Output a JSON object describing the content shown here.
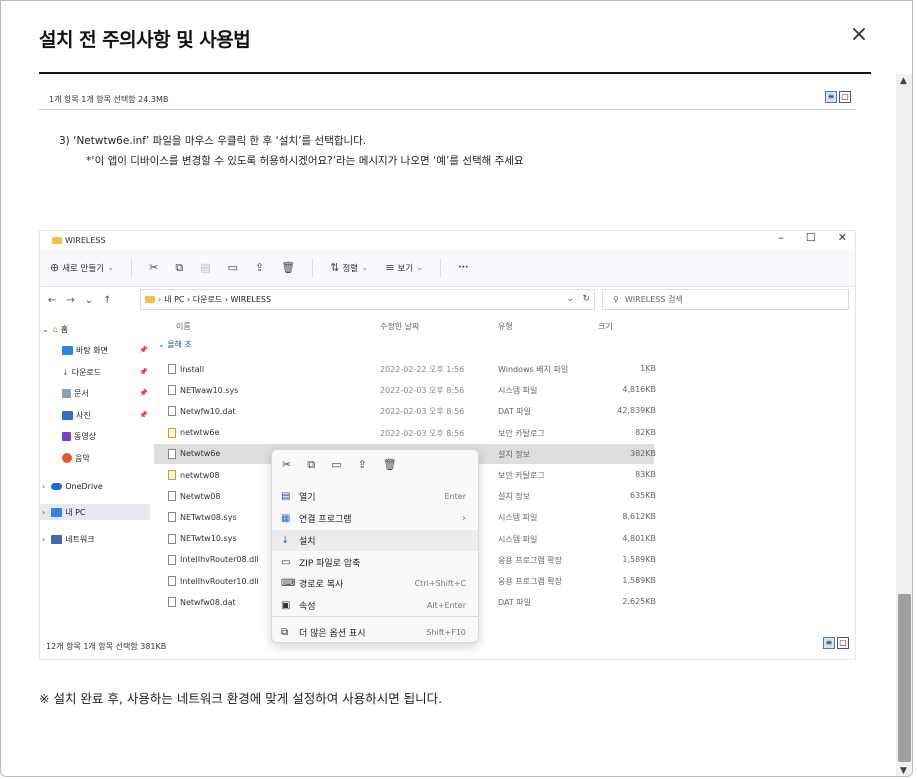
{
  "modal": {
    "title": "설치 전 주의사항 및 사용법",
    "close_icon": "×",
    "footer_note": "※ 설치 완료 후, 사용하는 네트워크 환경에 맞게 설정하여 사용하시면 됩니다."
  },
  "top_strip": {
    "status": "1개 항목    1개 항목 선택함 24.3MB"
  },
  "instructions": {
    "step3": "3)  ‘Netwtw6e.inf’ 파일을 마우스 우클릭 한 후 ‘설치’를 선택합니다.",
    "note": "*‘이 앱이 디바이스를 변경할 수 있도록 허용하시겠어요?’라는 메시지가 나오면 ‘예’를 선택해 주세요"
  },
  "explorer": {
    "window_title": "WIRELESS",
    "win_controls": {
      "min": "–",
      "max": "☐",
      "close": "✕"
    },
    "toolbar": {
      "new_label": "새로 만들기",
      "sort_label": "정렬",
      "view_label": "보기",
      "more": "···"
    },
    "address": {
      "path": "내 PC  ›  다운로드  ›  WIRELESS",
      "search_placeholder": "WIRELESS 검색"
    },
    "nav": {
      "home": "홈",
      "desktop": "바탕 화면",
      "downloads": "다운로드",
      "documents": "문서",
      "pictures": "사진",
      "videos": "동영상",
      "music": "음악",
      "onedrive": "OneDrive",
      "mypc": "내 PC",
      "network": "네트워크"
    },
    "columns": {
      "name": "이름",
      "date": "수정한 날짜",
      "type": "유형",
      "size": "크기"
    },
    "group": "⌄ 올해 초",
    "files": [
      {
        "name": "Install",
        "date": "2022-02-22 오후 1:56",
        "type": "Windows 배치 파일",
        "size": "1KB"
      },
      {
        "name": "NETwaw10.sys",
        "date": "2022-02-03 오후 8:56",
        "type": "시스템 파일",
        "size": "4,816KB"
      },
      {
        "name": "Netwfw10.dat",
        "date": "2022-02-03 오후 8:56",
        "type": "DAT 파일",
        "size": "42,839KB"
      },
      {
        "name": "netwtw6e",
        "date": "2022-02-03 오후 8:56",
        "type": "보안 카탈로그",
        "size": "82KB"
      },
      {
        "name": "Netwtw6e",
        "date": "",
        "type": "설치 정보",
        "size": "382KB"
      },
      {
        "name": "netwtw08",
        "date": "",
        "type": "보안 카탈로그",
        "size": "83KB"
      },
      {
        "name": "Netwtw08",
        "date": "",
        "type": "설치 정보",
        "size": "635KB"
      },
      {
        "name": "NETwtw08.sys",
        "date": "",
        "type": "시스템 파일",
        "size": "8,612KB"
      },
      {
        "name": "NETwtw10.sys",
        "date": "",
        "type": "시스템 파일",
        "size": "4,801KB"
      },
      {
        "name": "IntelIhvRouter08.dll",
        "date": "",
        "type": "응용 프로그램 확장",
        "size": "1,589KB"
      },
      {
        "name": "IntelIhvRouter10.dll",
        "date": "",
        "type": "응용 프로그램 확장",
        "size": "1,589KB"
      },
      {
        "name": "Netwfw08.dat",
        "date": "",
        "type": "DAT 파일",
        "size": "2,625KB"
      }
    ],
    "status": "12개 항목    1개 항목 선택함 381KB"
  },
  "context_menu": {
    "open": "열기",
    "open_short": "Enter",
    "open_with": "연결 프로그램",
    "install": "설치",
    "zip": "ZIP 파일로 압축",
    "copy_path": "경로로 복사",
    "copy_path_short": "Ctrl+Shift+C",
    "properties": "속성",
    "properties_short": "Alt+Enter",
    "more_options": "더 많은 옵션 표시",
    "more_options_short": "Shift+F10"
  }
}
